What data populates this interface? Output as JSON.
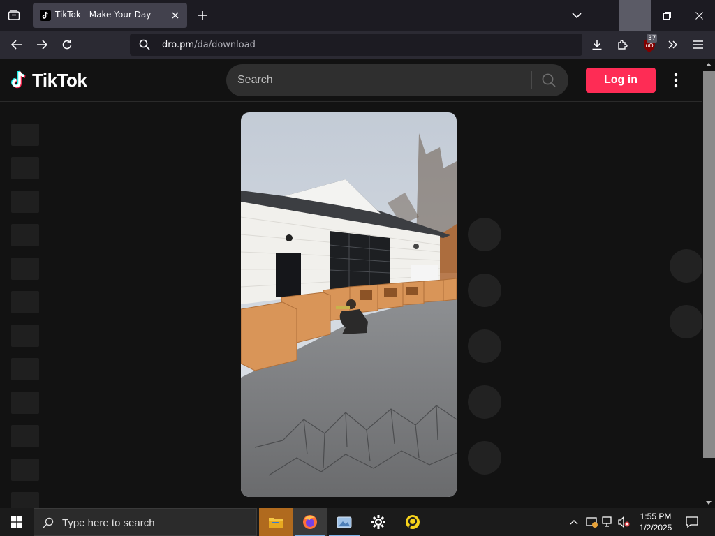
{
  "browser": {
    "tab_title": "TikTok - Make Your Day",
    "url_domain": "dro.pm",
    "url_path": "/da/download",
    "extension_badge": "37"
  },
  "tiktok": {
    "logo": "TikTok",
    "search_placeholder": "Search",
    "login_label": "Log in",
    "brand_color": "#fe2c55"
  },
  "taskbar": {
    "search_placeholder": "Type here to search",
    "time": "1:55 PM",
    "date": "1/2/2025"
  },
  "icons": {
    "tab_list": "tab-list-icon",
    "new_tab": "plus-icon",
    "back": "arrow-left-icon",
    "forward": "arrow-right-icon",
    "reload": "reload-icon",
    "download": "download-icon",
    "extensions": "puzzle-icon",
    "overflow": "chevron-double-right-icon",
    "menu": "hamburger-icon"
  }
}
